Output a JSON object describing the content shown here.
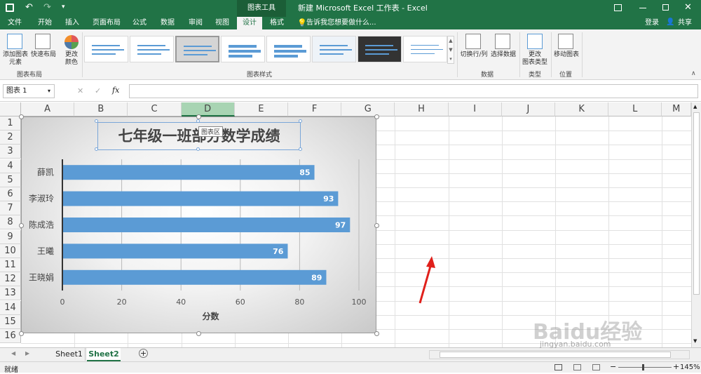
{
  "window": {
    "title": "新建 Microsoft Excel 工作表 - Excel",
    "context_tab": "图表工具"
  },
  "titlebar": {
    "save_icon": "save-icon",
    "undo_icon": "undo-icon",
    "redo_icon": "redo-icon"
  },
  "account": {
    "login": "登录",
    "share": "共享"
  },
  "tabs": [
    "文件",
    "开始",
    "插入",
    "页面布局",
    "公式",
    "数据",
    "审阅",
    "视图",
    "设计",
    "格式"
  ],
  "active_tab": "设计",
  "tell_me": "告诉我您想要做什么...",
  "ribbon": {
    "add_element": "添加图表\n元素",
    "quick_layout": "快速布局",
    "change_colors": "更改\n颜色",
    "group_layout": "图表布局",
    "group_styles": "图表样式",
    "switch_rowcol": "切换行/列",
    "select_data": "选择数据",
    "group_data": "数据",
    "change_type": "更改\n图表类型",
    "group_type": "类型",
    "move_chart": "移动图表",
    "group_location": "位置"
  },
  "formula_bar": {
    "name_box": "图表 1",
    "value": ""
  },
  "grid": {
    "columns": [
      "A",
      "B",
      "C",
      "D",
      "E",
      "F",
      "G",
      "H",
      "I",
      "J",
      "K",
      "L",
      "M"
    ],
    "selected_column": "D",
    "rows": [
      "1",
      "2",
      "3",
      "4",
      "5",
      "6",
      "7",
      "8",
      "9",
      "10",
      "11",
      "12",
      "13",
      "14",
      "15",
      "16"
    ]
  },
  "chart_data": {
    "type": "bar",
    "title": "七年级一班部分数学成绩",
    "categories": [
      "薛凯",
      "李淑玲",
      "陈成浩",
      "王曦",
      "王晓娟"
    ],
    "values": [
      85,
      93,
      97,
      76,
      89
    ],
    "xlabel": "分数",
    "ylabel": "",
    "xlim": [
      0,
      100
    ],
    "xticks": [
      "0",
      "20",
      "40",
      "60",
      "80",
      "100"
    ],
    "bar_color": "#5b9bd5",
    "chart_area_tooltip": "图表区"
  },
  "sheets": [
    "Sheet1",
    "Sheet2"
  ],
  "active_sheet": "Sheet2",
  "status": {
    "ready": "就绪",
    "zoom": "145%"
  },
  "watermark": {
    "brand": "Baidu经验",
    "url": "jingyan.baidu.com"
  }
}
